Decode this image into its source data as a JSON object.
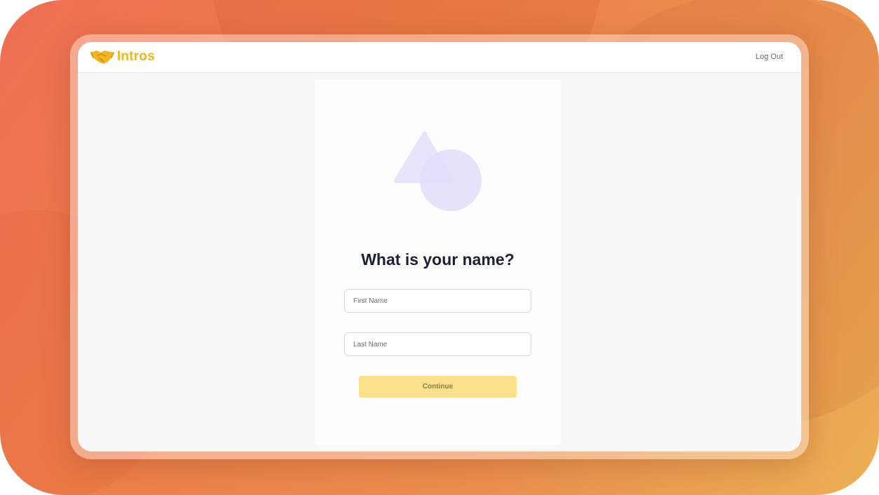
{
  "brand": {
    "name": "Intros",
    "logo_icon": "handshake-icon",
    "color": "#f2b51f"
  },
  "nav": {
    "logout_label": "Log Out"
  },
  "form": {
    "heading": "What is your name?",
    "first_name": {
      "value": "",
      "placeholder": "First Name"
    },
    "last_name": {
      "value": "",
      "placeholder": "Last Name"
    },
    "continue_label": "Continue",
    "continue_color": "#fde08a"
  },
  "illustration": {
    "icon": "shapes-illustration-icon",
    "color": "#e6e1fb"
  },
  "theme": {
    "background_gradient": [
      "#ef6f52",
      "#ecb055"
    ],
    "heading_color": "#1b2236"
  }
}
